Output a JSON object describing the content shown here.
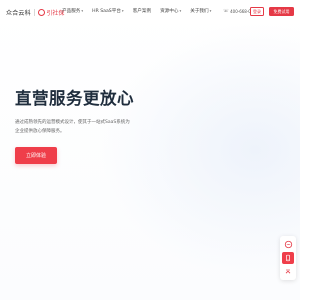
{
  "brand": {
    "main": "众合云科",
    "sub": "引社保"
  },
  "nav": {
    "items": [
      {
        "label": "产品服务"
      },
      {
        "label": "HR SaaS平台"
      },
      {
        "label": "客户案例"
      },
      {
        "label": "资源中心"
      },
      {
        "label": "关于我们"
      }
    ],
    "phone": "400-668-0731",
    "login_label": "登录",
    "trial_label": "免费试用"
  },
  "hero": {
    "title": "直营服务更放心",
    "description": "通过成熟领先的运营模式设计，使其于一站式SaaS系统为企业提供放心保障服务。",
    "cta_label": "立即体验"
  },
  "floating": {
    "items": [
      "consult",
      "phone",
      "back-to-top"
    ],
    "accent": "#ef3e4a"
  },
  "colors": {
    "accent": "#e53946",
    "title": "#1f2d3d",
    "text": "#666666"
  }
}
